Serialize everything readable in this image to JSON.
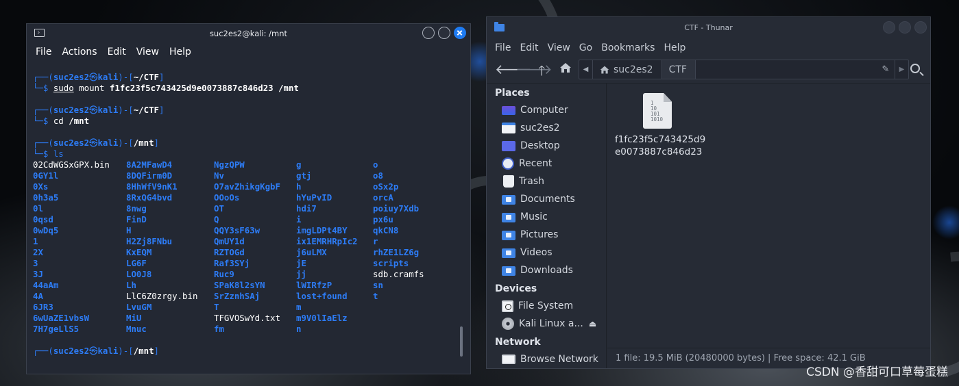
{
  "terminal": {
    "title": "suc2es2@kali: /mnt",
    "menu": [
      "File",
      "Actions",
      "Edit",
      "View",
      "Help"
    ],
    "prompts": [
      {
        "user": "suc2es2",
        "host": "kali",
        "path": "~/CTF"
      },
      {
        "user": "suc2es2",
        "host": "kali",
        "path": "~/CTF"
      },
      {
        "user": "suc2es2",
        "host": "kali",
        "path": "/mnt"
      },
      {
        "user": "suc2es2",
        "host": "kali",
        "path": "/mnt"
      }
    ],
    "symbols": {
      "at": "㉿",
      "open": "┌──(",
      "mid": ")-[",
      "close": "]",
      "arrow": "└─$ "
    },
    "commands": {
      "c1_sudo": "sudo",
      "c1_mount": " mount ",
      "c1_arg1": "f1fc23f5c743425d9e0073887c846d23",
      "c1_arg2": " /mnt",
      "c2_cd": "cd ",
      "c2_arg": "/mnt",
      "c3_ls": "ls"
    },
    "ls_rows": [
      [
        {
          "t": "02CdWGSxGPX.bin",
          "d": false
        },
        {
          "t": "8A2MFawD4",
          "d": true
        },
        {
          "t": "NgzQPW",
          "d": true
        },
        {
          "t": "g",
          "d": true
        },
        {
          "t": "o",
          "d": true
        }
      ],
      [
        {
          "t": "0GY1l",
          "d": true
        },
        {
          "t": "8DQFirm0D",
          "d": true
        },
        {
          "t": "Nv",
          "d": true
        },
        {
          "t": "gtj",
          "d": true
        },
        {
          "t": "o8",
          "d": true
        }
      ],
      [
        {
          "t": "0Xs",
          "d": true
        },
        {
          "t": "8HhWfV9nK1",
          "d": true
        },
        {
          "t": "O7avZhikgKgbF",
          "d": true
        },
        {
          "t": "h",
          "d": true
        },
        {
          "t": "oSx2p",
          "d": true
        }
      ],
      [
        {
          "t": "0h3a5",
          "d": true
        },
        {
          "t": "8RxQG4bvd",
          "d": true
        },
        {
          "t": "OOoOs",
          "d": true
        },
        {
          "t": "hYuPvID",
          "d": true
        },
        {
          "t": "orcA",
          "d": true
        }
      ],
      [
        {
          "t": "0l",
          "d": true
        },
        {
          "t": "8nwg",
          "d": true
        },
        {
          "t": "OT",
          "d": true
        },
        {
          "t": "hdi7",
          "d": true
        },
        {
          "t": "poiuy7Xdb",
          "d": true
        }
      ],
      [
        {
          "t": "0qsd",
          "d": true
        },
        {
          "t": "FinD",
          "d": true
        },
        {
          "t": "Q",
          "d": true
        },
        {
          "t": "i",
          "d": true
        },
        {
          "t": "px6u",
          "d": true
        }
      ],
      [
        {
          "t": "0wDq5",
          "d": true
        },
        {
          "t": "H",
          "d": true
        },
        {
          "t": "QQY3sF63w",
          "d": true
        },
        {
          "t": "imgLDPt4BY",
          "d": true
        },
        {
          "t": "qkCN8",
          "d": true
        }
      ],
      [
        {
          "t": "1",
          "d": true
        },
        {
          "t": "H2Zj8FNbu",
          "d": true
        },
        {
          "t": "QmUY1d",
          "d": true
        },
        {
          "t": "ix1EMRHRpIc2",
          "d": true
        },
        {
          "t": "r",
          "d": true
        }
      ],
      [
        {
          "t": "2X",
          "d": true
        },
        {
          "t": "KxEQM",
          "d": true
        },
        {
          "t": "RZTOGd",
          "d": true
        },
        {
          "t": "j6uLMX",
          "d": true
        },
        {
          "t": "rhZE1LZ6g",
          "d": true
        }
      ],
      [
        {
          "t": "3",
          "d": true
        },
        {
          "t": "LG6F",
          "d": true
        },
        {
          "t": "Raf3SYj",
          "d": true
        },
        {
          "t": "jE",
          "d": true
        },
        {
          "t": "scripts",
          "d": true
        }
      ],
      [
        {
          "t": "3J",
          "d": true
        },
        {
          "t": "LO0J8",
          "d": true
        },
        {
          "t": "Ruc9",
          "d": true
        },
        {
          "t": "jj",
          "d": true
        },
        {
          "t": "sdb.cramfs",
          "d": false
        }
      ],
      [
        {
          "t": "44aAm",
          "d": true
        },
        {
          "t": "Lh",
          "d": true
        },
        {
          "t": "SPaK8l2sYN",
          "d": true
        },
        {
          "t": "lWIRfzP",
          "d": true
        },
        {
          "t": "sn",
          "d": true
        }
      ],
      [
        {
          "t": "4A",
          "d": true
        },
        {
          "t": "LlC6Z0zrgy.bin",
          "d": false
        },
        {
          "t": "SrZznhSAj",
          "d": true
        },
        {
          "t": "lost+found",
          "d": true
        },
        {
          "t": "t",
          "d": true
        }
      ],
      [
        {
          "t": "6JR3",
          "d": true
        },
        {
          "t": "LvuGM",
          "d": true
        },
        {
          "t": "T",
          "d": true
        },
        {
          "t": "m",
          "d": true
        },
        {
          "t": "",
          "d": false
        }
      ],
      [
        {
          "t": "6wUaZE1vbsW",
          "d": true
        },
        {
          "t": "MiU",
          "d": true
        },
        {
          "t": "TFGVOSwYd.txt",
          "d": false
        },
        {
          "t": "m9V0lIaElz",
          "d": true
        },
        {
          "t": "",
          "d": false
        }
      ],
      [
        {
          "t": "7H7geLlS5",
          "d": true
        },
        {
          "t": "Mnuc",
          "d": true
        },
        {
          "t": "fm",
          "d": true
        },
        {
          "t": "n",
          "d": true
        },
        {
          "t": "",
          "d": false
        }
      ]
    ]
  },
  "thunar": {
    "title": "CTF - Thunar",
    "menu": [
      "File",
      "Edit",
      "View",
      "Go",
      "Bookmarks",
      "Help"
    ],
    "path": [
      "suc2es2",
      "CTF"
    ],
    "sidebar": {
      "places_label": "Places",
      "places": [
        {
          "label": "Computer",
          "icon": "computer-icon"
        },
        {
          "label": "suc2es2",
          "icon": "home-folder-icon"
        },
        {
          "label": "Desktop",
          "icon": "desktop-icon"
        },
        {
          "label": "Recent",
          "icon": "recent-icon"
        },
        {
          "label": "Trash",
          "icon": "trash-icon"
        },
        {
          "label": "Documents",
          "icon": "documents-folder-icon"
        },
        {
          "label": "Music",
          "icon": "music-folder-icon"
        },
        {
          "label": "Pictures",
          "icon": "pictures-folder-icon"
        },
        {
          "label": "Videos",
          "icon": "videos-folder-icon"
        },
        {
          "label": "Downloads",
          "icon": "downloads-folder-icon"
        }
      ],
      "devices_label": "Devices",
      "devices": [
        {
          "label": "File System",
          "icon": "filesystem-icon"
        },
        {
          "label": "Kali Linux a...",
          "icon": "disc-icon"
        }
      ],
      "network_label": "Network",
      "network": [
        {
          "label": "Browse Network",
          "icon": "network-icon"
        }
      ]
    },
    "file": {
      "name": "f1fc23f5c743425d9e0073887c846d23",
      "icon_text": "1\n10\n101\n1010"
    },
    "status": "1 file: 19.5 MiB (20480000 bytes) | Free space: 42.1 GiB"
  },
  "watermark": "CSDN @香甜可口草莓蛋糕",
  "colors": {
    "accent": "#2d7cf6",
    "folder": "#3f84e5"
  }
}
